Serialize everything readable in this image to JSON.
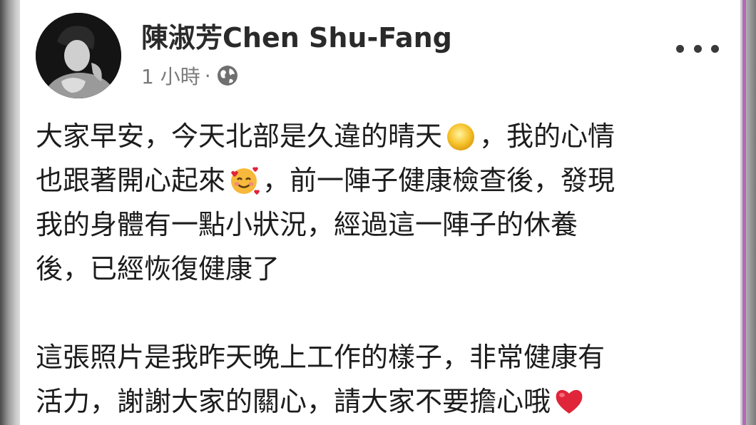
{
  "post": {
    "author": "陳淑芳Chen Shu-Fang",
    "time": "1 小時",
    "separator": "·",
    "privacy_icon": "globe-icon",
    "more_icon": "more-options-icon"
  },
  "content": {
    "p1_l1_a": "大家早安，今天北部是久違的晴天",
    "p1_l1_emoji": "sun-emoji",
    "p1_l1_b": "，我的心情",
    "p1_l2_a": "也跟著開心起來",
    "p1_l2_emoji": "smiling-face-with-hearts-emoji",
    "p1_l2_b": "，前一陣子健康檢查後，發現",
    "p1_l3": "我的身體有一點小狀況，經過這一陣子的休養",
    "p1_l4": "後，已經恢復健康了",
    "p2_l1": "這張照片是我昨天晚上工作的樣子，非常健康有",
    "p2_l2": "活力，謝謝大家的關心，請大家不要擔心哦",
    "p2_l2_emoji": "red-heart-emoji"
  },
  "colors": {
    "text": "#1c1c1c",
    "meta": "#7a7a7a",
    "heart": "#e0243a",
    "sun": "#f7c531"
  }
}
